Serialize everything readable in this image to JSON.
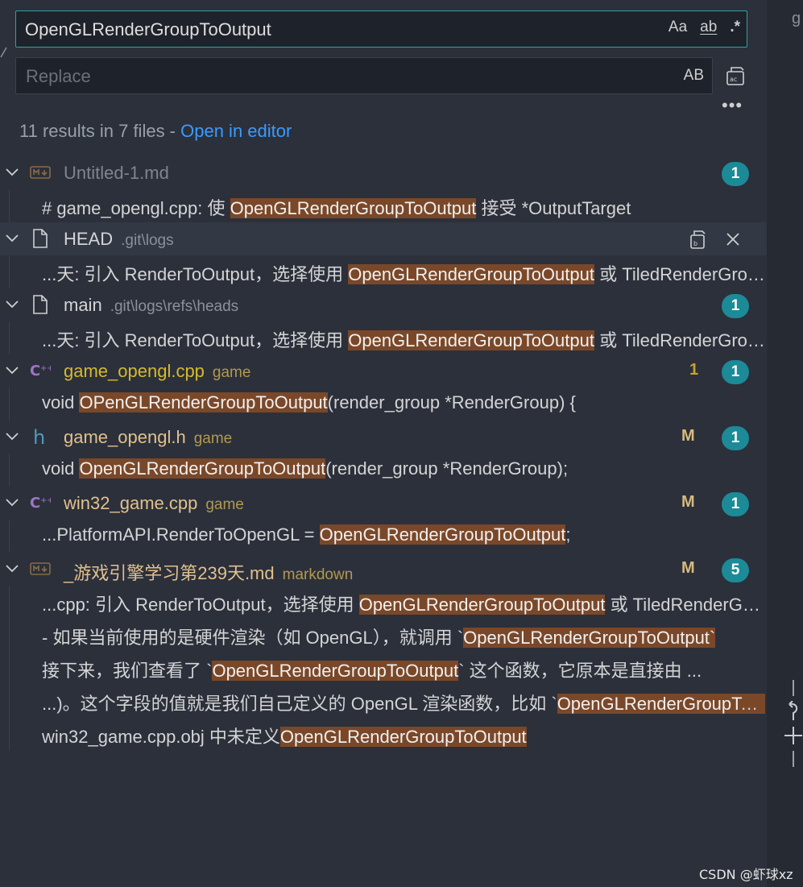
{
  "search": {
    "query": "OpenGLRenderGroupToOutput",
    "opt_case": "Aa",
    "opt_word": "ab",
    "opt_regex": ".*"
  },
  "replace": {
    "placeholder": "Replace",
    "preserve_case": "AB"
  },
  "summary": {
    "text": "11 results in 7 files - ",
    "link": "Open in editor"
  },
  "right_strip_letter": "g",
  "colors": {
    "accent": "#3a9ea5",
    "badge": "#1c8a97",
    "highlight": "#7a4829",
    "link": "#3b9bff",
    "modified": "#d7ba7d"
  },
  "files": [
    {
      "icon": "markdown-icon",
      "name": "Untitled-1.md",
      "dir": "",
      "name_color": "#7f848e",
      "status": "",
      "count": "1",
      "matches": [
        {
          "pre": "# game_opengl.cpp: 使 ",
          "hit": "OpenGLRenderGroupToOutput",
          "post": " 接受 *OutputTarget"
        }
      ]
    },
    {
      "icon": "file-icon",
      "name": "HEAD",
      "dir": ".git\\logs",
      "name_color": "#d4d4d4",
      "status": "",
      "count": "",
      "hovered": true,
      "matches": [
        {
          "pre": "...天: 引入 RenderToOutput，选择使用 ",
          "hit": "OpenGLRenderGroupToOutput",
          "post": " 或 TiledRenderGroupToOutput"
        }
      ]
    },
    {
      "icon": "file-icon",
      "name": "main",
      "dir": ".git\\logs\\refs\\heads",
      "name_color": "#d4d4d4",
      "status": "",
      "count": "1",
      "matches": [
        {
          "pre": "...天: 引入 RenderToOutput，选择使用 ",
          "hit": "OpenGLRenderGroupToOutput",
          "post": " 或 TiledRenderGroupToOutput"
        }
      ]
    },
    {
      "icon": "cpp-icon",
      "name": "game_opengl.cpp",
      "dir": "game",
      "name_color": "#d7ba2a",
      "status": "1",
      "count": "1",
      "matches": [
        {
          "pre": "void ",
          "hit": "OPenGLRenderGroupToOutput",
          "post": "(render_group *RenderGroup) {"
        }
      ]
    },
    {
      "icon": "header-icon",
      "name": "game_opengl.h",
      "dir": "game",
      "name_color": "#e2c08d",
      "status": "M",
      "count": "1",
      "matches": [
        {
          "pre": "void ",
          "hit": "OpenGLRenderGroupToOutput",
          "post": "(render_group *RenderGroup);"
        }
      ]
    },
    {
      "icon": "cpp-icon",
      "name": "win32_game.cpp",
      "dir": "game",
      "name_color": "#e2c08d",
      "status": "M",
      "count": "1",
      "matches": [
        {
          "pre": "...PlatformAPI.RenderToOpenGL = ",
          "hit": "OpenGLRenderGroupToOutput",
          "post": ";"
        }
      ]
    },
    {
      "icon": "markdown-icon",
      "name": "_游戏引擎学习第239天.md",
      "dir": "markdown",
      "name_color": "#e2c08d",
      "status": "M",
      "count": "5",
      "matches": [
        {
          "pre": "...cpp: 引入 RenderToOutput，选择使用 ",
          "hit": "OpenGLRenderGroupToOutput",
          "post": " 或 TiledRenderGroupToOutput"
        },
        {
          "pre": "- 如果当前使用的是硬件渲染（如 OpenGL），就调用 `",
          "hit": "OpenGLRenderGroupToOutput`",
          "post": ""
        },
        {
          "pre": "接下来，我们查看了 `",
          "hit": "OpenGLRenderGroupToOutput",
          "post": "` 这个函数，它原本是直接由 ..."
        },
        {
          "pre": "...)。这个字段的值就是我们自己定义的 OpenGL 渲染函数，比如 `",
          "hit": "OpenGLRenderGroupToOutput`",
          "post": ""
        },
        {
          "pre": "win32_game.cpp.obj 中未定义",
          "hit": "OpenGLRenderGroupToOutput",
          "post": ""
        }
      ]
    }
  ],
  "watermark": "CSDN @虾球xz"
}
